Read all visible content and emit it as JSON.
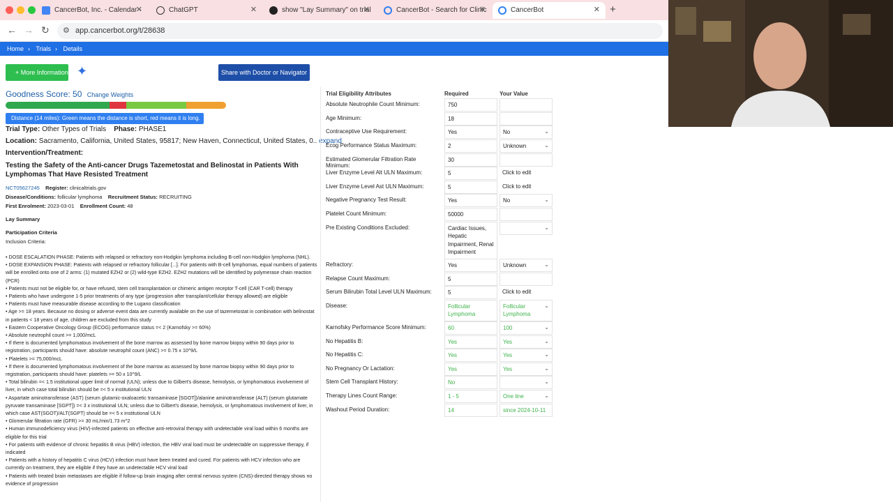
{
  "browser": {
    "tabs": [
      {
        "label": "CancerBot, Inc. - Calendar -",
        "icon": "calendar-icon"
      },
      {
        "label": "ChatGPT",
        "icon": "chatgpt-icon"
      },
      {
        "label": "show \"Lay Summary\" on trial",
        "icon": "github-icon"
      },
      {
        "label": "CancerBot - Search for Clinic",
        "icon": "cancerbot-icon"
      },
      {
        "label": "CancerBot",
        "icon": "cancerbot-icon",
        "active": true
      }
    ],
    "url": "app.cancerbot.org/t/28638"
  },
  "breadcrumb": [
    "Home",
    "Trials",
    "Details"
  ],
  "buttons": {
    "more_info": "More Information",
    "share": "Share with Doctor or Navigator"
  },
  "score": {
    "label": "Goodness Score: 50",
    "change_weights": "Change Weights",
    "tooltip": "Distance (14 miles): Green means the distance is short, red means it is long."
  },
  "trial": {
    "type_label": "Trial Type:",
    "type_value": "Other Types of Trials",
    "phase_label": "Phase:",
    "phase_value": "PHASE1",
    "location_label": "Location:",
    "location_value": "Sacramento, California, United States, 95817; New Haven, Connecticut, United States, 0..",
    "expand": "expand",
    "intervention_label": "Intervention/Treatment:",
    "title": "Testing the Safety of the Anti-cancer Drugs Tazemetostat and Belinostat in Patients With Lymphomas That Have Resisted Treatment",
    "nct": "NCT05627245",
    "register_label": "Register:",
    "register_value": "clinicaltrials.gov",
    "disease_label": "Disease/Conditions:",
    "disease_value": "follicular lymphoma",
    "recruit_label": "Recruitment Status:",
    "recruit_value": "RECRUITING",
    "enrol_label": "First Enrolment:",
    "enrol_value": "2023-03-01",
    "count_label": "Enrollment Count:",
    "count_value": "48",
    "lay_summary": "Lay Summary",
    "participation": "Participation Criteria",
    "inclusion": "Inclusion Criteria:",
    "criteria": [
      "•  DOSE ESCALATION PHASE: Patients with relapsed or refractory non-Hodgkin lymphoma including B-cell non-Hodgkin lymphoma (NHL).",
      "•  DOSE EXPANSION PHASE: Patients with relapsed or refractory follicular [...]. For patients with B-cell lymphomas, equal numbers of patients will be enrolled onto one of 2 arms: (1) mutated EZH2 or (2) wild-type EZH2. EZH2 mutations will be identified by polymerase chain reaction (PCR)",
      "•  Patients must not be eligible for, or have refused, stem cell transplantation or chimeric antigen receptor T-cell (CAR T-cell) therapy",
      "•  Patients who have undergone 1-5 prior treatments of any type (progression after transplant/cellular therapy allowed) are eligible",
      "•  Patients must have measurable disease according to the Lugano classification",
      "•  Age >= 18 years. Because no dosing or adverse event data are currently available on the use of tazemetostat in combination with belinostat in patients < 18 years of age, children are excluded from this study",
      "•  Eastern Cooperative Oncology Group (ECOG) performance status =< 2 (Karnofsky >= 60%)",
      "•  Absolute neutrophil count >= 1,000/mcL",
      "   •  If there is documented lymphomatous involvement of the bone marrow as assessed by bone marrow biopsy within 90 days prior to registration, participants should have: absolute neutrophil count (ANC) >= 0.75 x 10^9/L",
      "•  Platelets >= 75,000/mcL",
      "   •  If there is documented lymphomatous involvement of the bone marrow as assessed by bone marrow biopsy within 90 days prior to registration, participants should have: platelets >= 50 x 10^9/L",
      "•  Total bilirubin =< 1.5 institutional upper limit of normal (ULN); unless due to Gilbert's disease, hemolysis, or lymphomatous involvement of liver, in which case total bilirubin should be =< 5 x institutional ULN",
      "•  Aspartate aminotransferase (AST) (serum glutamic-oxaloacetic transaminase [SGOT])/alanine aminotransferase (ALT) (serum glutamate pyruvate transaminase [SGPT]) =< 3 x institutional ULN; unless due to Gilbert's disease, hemolysis, or lymphomatous involvement of liver, in which case AST(SGOT)/ALT(SGPT) should be =< 5 x institutional ULN",
      "•  Glomerular filtration rate (GFR) >= 30 mL/min/1.73 m^2",
      "•  Human immunodeficiency virus (HIV)-infected patients on effective anti-retroviral therapy with undetectable viral load within 6 months are eligible for this trial",
      "•  For patients with evidence of chronic hepatitis B virus (HBV) infection, the HBV viral load must be undetectable on suppressive therapy, if indicated",
      "•  Patients with a history of hepatitis C virus (HCV) infection must have been treated and cured. For patients with HCV infection who are currently on treatment, they are eligible if they have an undetectable HCV viral load",
      "•  Patients with treated brain metastases are eligible if follow-up brain imaging after central nervous system (CNS)-directed therapy shows no evidence of progression"
    ]
  },
  "eligibility": {
    "headers": [
      "Trial Eligibility Attributes",
      "Required",
      "Your Value"
    ],
    "rows": [
      {
        "label": "Absolute Neutrophile Count Minimum:",
        "required": "750",
        "value": ""
      },
      {
        "label": "Age Minimum:",
        "required": "18",
        "value": ""
      },
      {
        "label": "Contraceptive Use Requirement:",
        "required": "Yes",
        "value": "No",
        "dropdown": true
      },
      {
        "label": "Ecog Performance Status Maximum:",
        "required": "2",
        "value": "Unknown",
        "dropdown": true
      },
      {
        "label": "Estimated Glomerular Filtration Rate Minimum:",
        "required": "30",
        "value": ""
      },
      {
        "label": "Liver Enzyme Level Alt ULN Maximum:",
        "required": "5",
        "value": "Click to edit"
      },
      {
        "label": "Liver Enzyme Level Ast ULN Maximum:",
        "required": "5",
        "value": "Click to edit"
      },
      {
        "label": "Negative Pregnancy Test Result:",
        "required": "Yes",
        "value": "No",
        "dropdown": true
      },
      {
        "label": "Platelet Count Minimum:",
        "required": "50000",
        "value": ""
      },
      {
        "label": "Pre Existing Conditions Excluded:",
        "required": "Cardiac Issues, Hepatic Impairment, Renal Impairment",
        "value": "",
        "dropdown": true
      },
      {
        "label": "Refractory:",
        "required": "Yes",
        "value": "Unknown",
        "dropdown": true
      },
      {
        "label": "Relapse Count Maximum:",
        "required": "5",
        "value": ""
      },
      {
        "label": "Serum Bilirubin Total Level ULN Maximum:",
        "required": "5",
        "value": "Click to edit"
      },
      {
        "label": "Disease:",
        "required": "Follicular Lymphoma",
        "value": "Follicular Lymphoma",
        "dropdown": true,
        "match": true
      },
      {
        "label": "Karnofsky Performance Score Minimum:",
        "required": "60",
        "value": "100",
        "dropdown": true,
        "match": true
      },
      {
        "label": "No Hepatitis B:",
        "required": "Yes",
        "value": "Yes",
        "dropdown": true,
        "match": true
      },
      {
        "label": "No Hepatitis C:",
        "required": "Yes",
        "value": "Yes",
        "dropdown": true,
        "match": true
      },
      {
        "label": "No Pregnancy Or Lactation:",
        "required": "Yes",
        "value": "Yes",
        "dropdown": true,
        "match": true
      },
      {
        "label": "Stem Cell Transplant History:",
        "required": "No",
        "value": "",
        "dropdown": true,
        "match": true
      },
      {
        "label": "Therapy Lines Count Range:",
        "required": "1 - 5",
        "value": "One line",
        "dropdown": true,
        "match": true
      },
      {
        "label": "Washout Period Duration:",
        "required": "14",
        "value": "since 2024-10-11",
        "match": true
      }
    ]
  },
  "colors": {
    "accent": "#1f6fe5",
    "green": "#2dbe4f",
    "navy": "#1e4fa8",
    "match": "#3fb24b"
  }
}
